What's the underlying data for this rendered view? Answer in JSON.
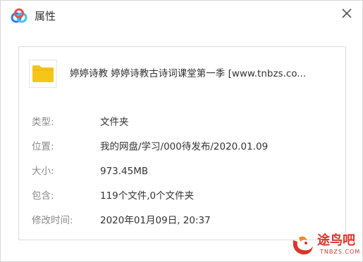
{
  "window": {
    "title": "属性"
  },
  "icons": {
    "app": "baidu-netdisk-cloud-icon",
    "close": "close-icon",
    "folder": "folder-icon",
    "watermark": "tuniaoba-logo-icon"
  },
  "file": {
    "name": "婷婷诗教 婷婷诗教古诗词课堂第一季 [www.tnbzs.co..."
  },
  "properties": [
    {
      "label": "类型:",
      "value": "文件夹"
    },
    {
      "label": "位置:",
      "value": "我的网盘/学习/000待发布/2020.01.09"
    },
    {
      "label": "大小:",
      "value": "973.45MB"
    },
    {
      "label": "包含:",
      "value": "119个文件,0个文件夹"
    },
    {
      "label": "修改时间:",
      "value": "2020年01月09日, 20:37"
    }
  ],
  "watermark": {
    "text": "途鸟吧",
    "sub": "TNBZS.COM"
  },
  "colors": {
    "folder": "#f5c518",
    "label": "#8a8a8a",
    "value": "#333333",
    "watermark": "#d9362b"
  }
}
